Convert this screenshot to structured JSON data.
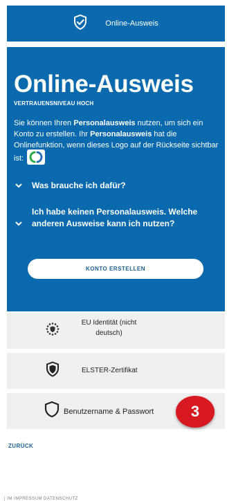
{
  "header": {
    "title": "Online-Ausweis"
  },
  "panel": {
    "title": "Online-Ausweis",
    "subtitle": "VERTRAUENSNIVEAU HOCH",
    "desc_1": "Sie können Ihren ",
    "desc_2": "Personalausweis",
    "desc_3": " nutzen, um sich ein Konto zu erstellen. Ihr ",
    "desc_4": "Personalausweis",
    "desc_5": " hat die Onlinefunktion, wenn dieses Logo auf der Rückseite sichtbar ist:",
    "faq_1": "Was brauche ich dafür?",
    "faq_2": "Ich habe keinen Personalausweis. Welche anderen Ausweise kann ich nutzen?",
    "cta": "KONTO ERSTELLEN"
  },
  "options": [
    {
      "label": "EU Identität (nicht deutsch)",
      "icon": "eu-stars-icon"
    },
    {
      "label": "ELSTER-Zertifikat",
      "icon": "shield-icon"
    },
    {
      "label": "Benutzername & Passwort",
      "icon": "shield-outline-icon"
    }
  ],
  "step_marker": "3",
  "back_link": "ZURÜCK",
  "footer_cut": "| IM IMPRESSUM DATENSCHUTZ",
  "colors": {
    "primary_blue": "#0a6aad",
    "option_bg": "#efefef",
    "step_red": "#d71921",
    "link_blue": "#1b5e93"
  }
}
